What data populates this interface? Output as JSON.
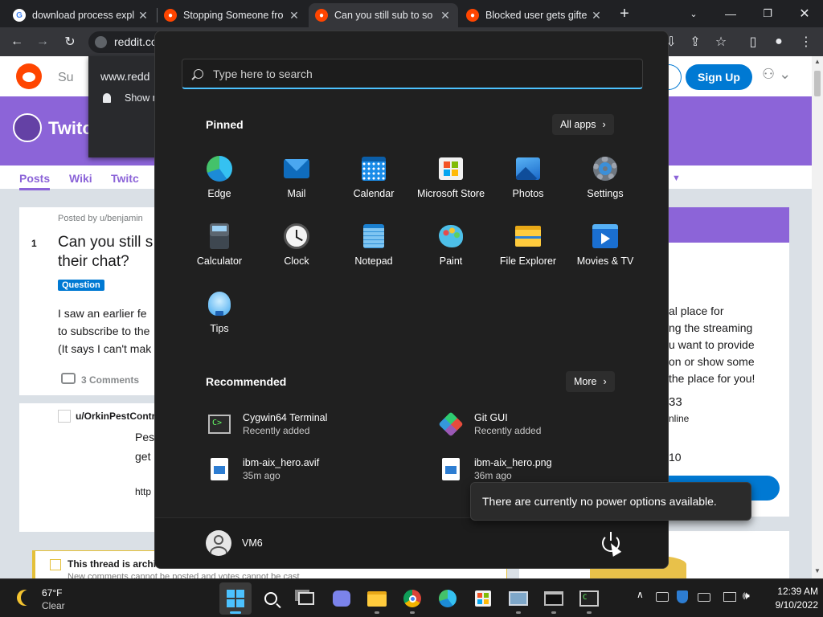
{
  "browser": {
    "tabs": [
      {
        "title": "download process expl",
        "favicon": "google-icon",
        "active": false
      },
      {
        "title": "Stopping Someone fro",
        "favicon": "reddit-icon",
        "active": false
      },
      {
        "title": "Can you still sub to so",
        "favicon": "reddit-icon",
        "active": true
      },
      {
        "title": "Blocked user gets gifte",
        "favicon": "reddit-icon",
        "active": false
      }
    ],
    "new_tab": "+",
    "omnibox_text": "reddit.co",
    "site_popup": {
      "host": "www.redd",
      "notification_text": "Show n"
    }
  },
  "reddit": {
    "brand_partial": "Su",
    "sign_up": "Sign Up",
    "community_name_partial": "Twitc",
    "nav": {
      "posts": "Posts",
      "wiki": "Wiki",
      "twitch_partial": "Twitc"
    },
    "post": {
      "posted_by": "Posted by u/benjamin",
      "votes": "1",
      "title_line1": "Can you still s",
      "title_line2": "their chat?",
      "flair": "Question",
      "body_line1": "I saw an earlier fe",
      "body_line2": "to subscribe to the",
      "body_line3": "(It says I can't mak",
      "comments": "3 Comments"
    },
    "comment": {
      "author": "u/OrkinPestContr",
      "line1": "Pes",
      "line2": "get",
      "line3": "http"
    },
    "sidebar": {
      "line1": "al place for",
      "line2": "ng the streaming",
      "line3": "u want to provide",
      "line4": "on or show some",
      "line5": "the place for you!",
      "members": "33",
      "online": "nline",
      "num": "10"
    },
    "archived_text": "This thread is archi",
    "archived_sub": "New comments cannot be posted and votes cannot be cast"
  },
  "start_menu": {
    "search_placeholder": "Type here to search",
    "pinned_title": "Pinned",
    "all_apps": "All apps",
    "pinned": [
      {
        "label": "Edge",
        "icon": "edge-icon"
      },
      {
        "label": "Mail",
        "icon": "mail-icon"
      },
      {
        "label": "Calendar",
        "icon": "calendar-icon"
      },
      {
        "label": "Microsoft Store",
        "icon": "store-icon"
      },
      {
        "label": "Photos",
        "icon": "photos-icon"
      },
      {
        "label": "Settings",
        "icon": "settings-icon"
      },
      {
        "label": "Calculator",
        "icon": "calculator-icon"
      },
      {
        "label": "Clock",
        "icon": "clock-icon"
      },
      {
        "label": "Notepad",
        "icon": "notepad-icon"
      },
      {
        "label": "Paint",
        "icon": "paint-icon"
      },
      {
        "label": "File Explorer",
        "icon": "folder-icon"
      },
      {
        "label": "Movies & TV",
        "icon": "movies-icon"
      },
      {
        "label": "Tips",
        "icon": "tips-icon"
      }
    ],
    "recommended_title": "Recommended",
    "more": "More",
    "recommended": [
      {
        "name": "Cygwin64 Terminal",
        "sub": "Recently added",
        "icon": "terminal-icon"
      },
      {
        "name": "Git GUI",
        "sub": "Recently added",
        "icon": "git-icon"
      },
      {
        "name": "ibm-aix_hero.avif",
        "sub": "35m ago",
        "icon": "image-file-icon"
      },
      {
        "name": "ibm-aix_hero.png",
        "sub": "36m ago",
        "icon": "image-file-icon"
      }
    ],
    "user": "VM6",
    "power_tooltip": "There are currently no power options available."
  },
  "taskbar": {
    "weather_temp": "67°F",
    "weather_desc": "Clear",
    "time": "12:39 AM",
    "date": "9/10/2022"
  },
  "colors": {
    "reddit_orange": "#ff4500",
    "reddit_blue": "#0079d3",
    "banner_purple": "#8c64d8",
    "accent_blue": "#4cc2ff"
  }
}
